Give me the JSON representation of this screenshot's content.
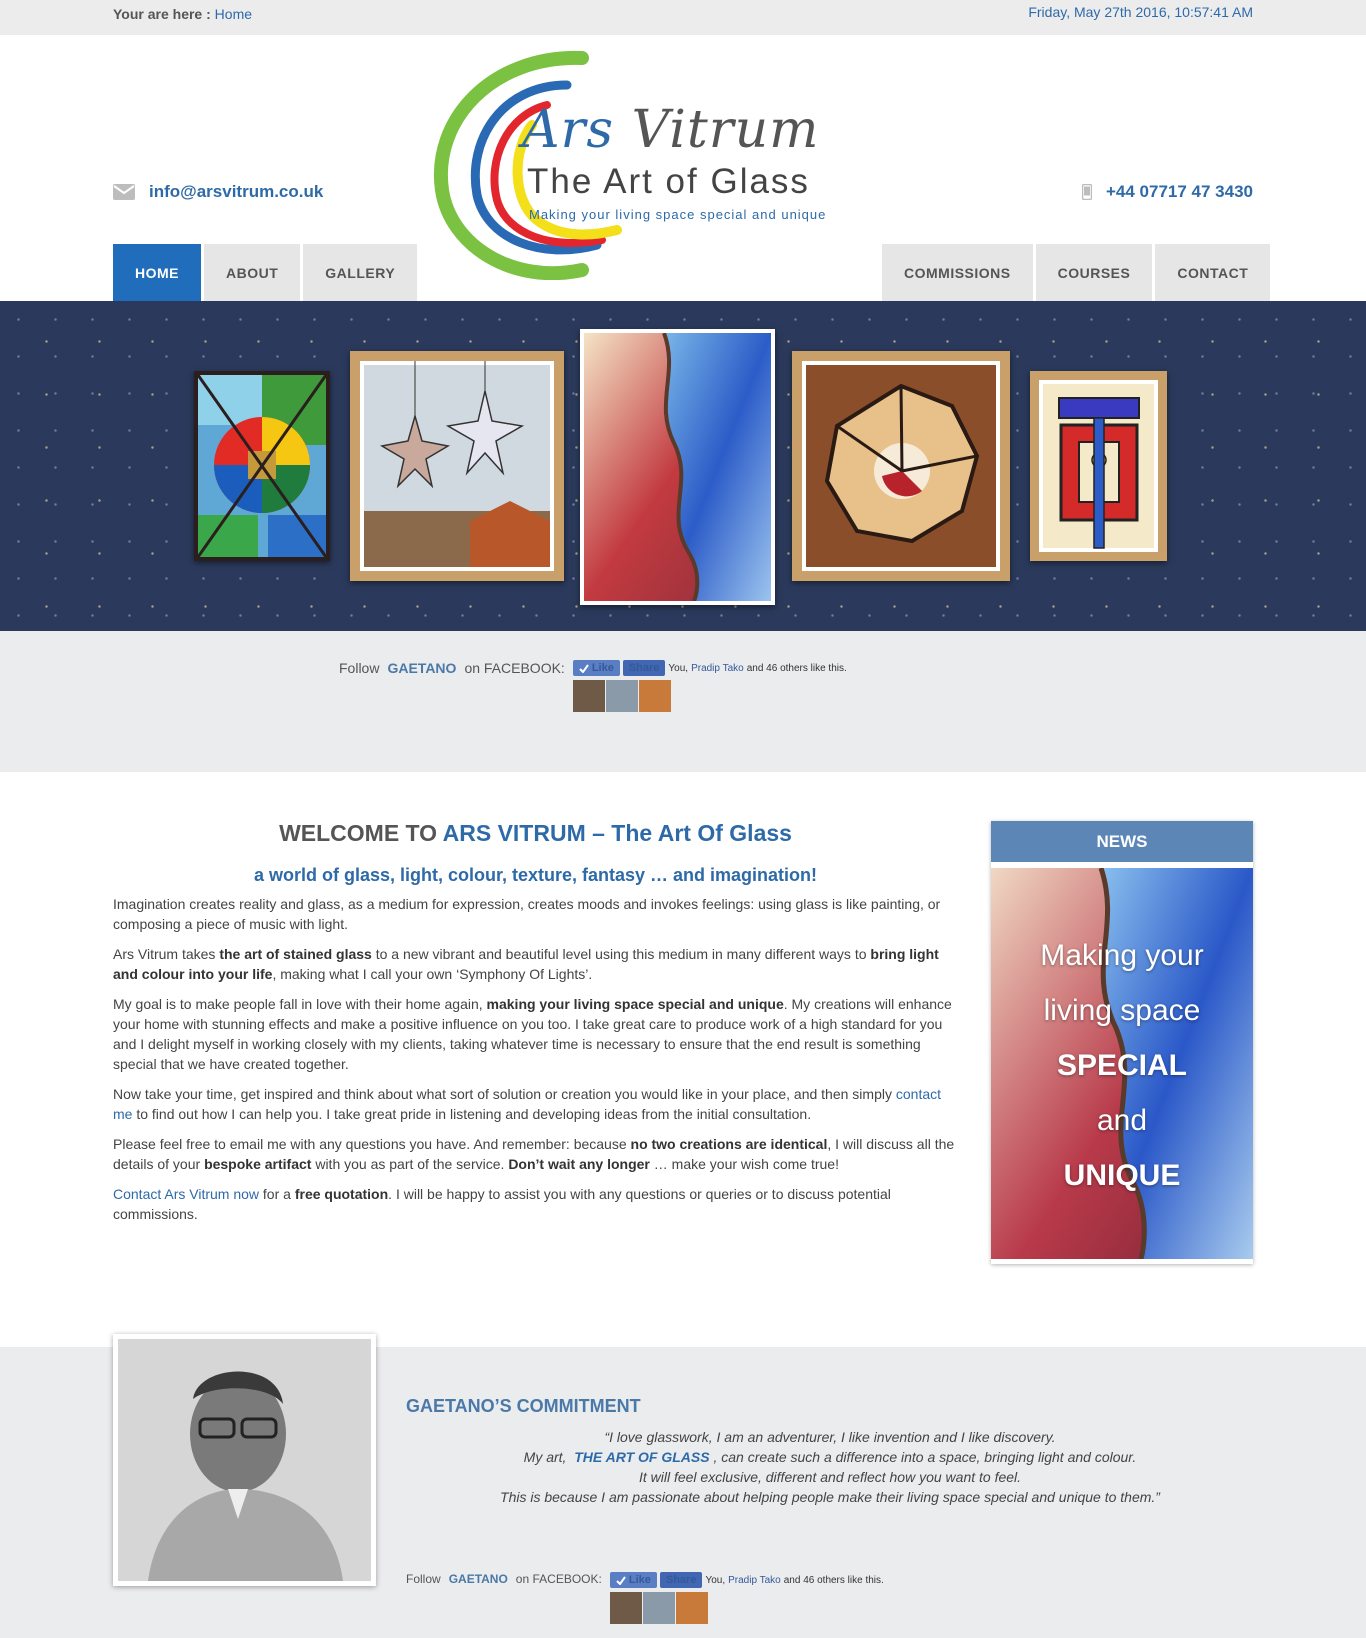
{
  "topbar": {
    "breadcrumb_label": "Your are here :",
    "breadcrumb_home": "Home",
    "datetime": "Friday, May 27th 2016, 10:57:41 AM"
  },
  "header": {
    "email": "info@arsvitrum.co.uk",
    "phone": "+44 07717 47 3430",
    "logo_word1": "Ars",
    "logo_word2": "Vitrum",
    "logo_tagline": "The Art of Glass",
    "logo_slogan": "Making your living space special and unique"
  },
  "nav": {
    "left": [
      "HOME",
      "ABOUT",
      "GALLERY"
    ],
    "right": [
      "COMMISSIONS",
      "COURSES",
      "CONTACT"
    ],
    "active": "HOME"
  },
  "follow": {
    "prefix": "Follow",
    "name": "GAETANO",
    "suffix": "on FACEBOOK:",
    "like_label": "Like",
    "share_label": "Share",
    "likes_prefix": "You,",
    "likes_friend": "Pradip Tako",
    "likes_suffix": "and 46 others like this."
  },
  "welcome": {
    "title_prefix": "WELCOME TO",
    "title_highlight": "ARS VITRUM – The Art Of Glass",
    "subtitle": "a world of glass, light, colour, texture, fantasy … and imagination!",
    "p1": "Imagination creates reality and glass, as a medium for expression, creates moods and invokes feelings: using glass is like painting, or composing a piece of music with light.",
    "p2_a": "Ars Vitrum takes",
    "p2_b": "the art of stained glass",
    "p2_c": "to a new vibrant and beautiful level using this medium in many different ways to",
    "p2_d": "bring light and colour into your life",
    "p2_e": ", making what I call your own ‘Symphony Of Lights’.",
    "p3_a": "My goal is to make people fall in love with their home again,",
    "p3_b": "making your living space special and unique",
    "p3_c": ". My creations will enhance your home with stunning effects and make a positive influence on you too. I take great care to produce work of a high standard for you and I delight myself in working closely with my clients, taking whatever time is necessary to ensure that the end result is something special that we have created together.",
    "p4_a": "Now take your time, get inspired and think about what sort of solution or creation you would like in your place, and then simply",
    "p4_link": "contact me",
    "p4_b": "to find out how I can help you. I take great pride in listening and developing ideas from the initial consultation.",
    "p5_a": "Please feel free to email me with any questions you have. And remember: because",
    "p5_b": "no two creations are identical",
    "p5_c": ", I will discuss all the details of your",
    "p5_d": "bespoke artifact",
    "p5_e": "with you as part of the service.",
    "p5_f": "Don’t wait any longer",
    "p5_g": "… make your wish come true!",
    "p6_link": "Contact Ars Vitrum now",
    "p6_a": "for a",
    "p6_b": "free quotation",
    "p6_c": ". I will be happy to assist you with any questions or queries or to discuss potential commissions."
  },
  "news": {
    "title": "NEWS",
    "line1": "Making your",
    "line2": "living space",
    "line3": "SPECIAL",
    "line4": "and",
    "line5": "UNIQUE"
  },
  "commitment": {
    "title": "GAETANO’S COMMITMENT",
    "q1": "“I love glasswork, I am an adventurer, I like invention and I like discovery.",
    "q2_a": "My art,",
    "q2_b": "THE ART OF GLASS",
    "q2_c": ", can create such a difference into a space, bringing light and colour.",
    "q3": "It will feel exclusive, different and reflect how you want to feel.",
    "q4": "This is because I am passionate about helping people make their living space special and unique to them.”"
  },
  "colors": {
    "accent": "#2e6aa8",
    "nav_active": "#1f6dbb",
    "news_header": "#5c86b5",
    "gallery_bg": "#2b3a5c",
    "facebook": "#4267b2"
  },
  "icons": [
    "envelope-icon",
    "mobile-phone-icon",
    "check-icon"
  ]
}
